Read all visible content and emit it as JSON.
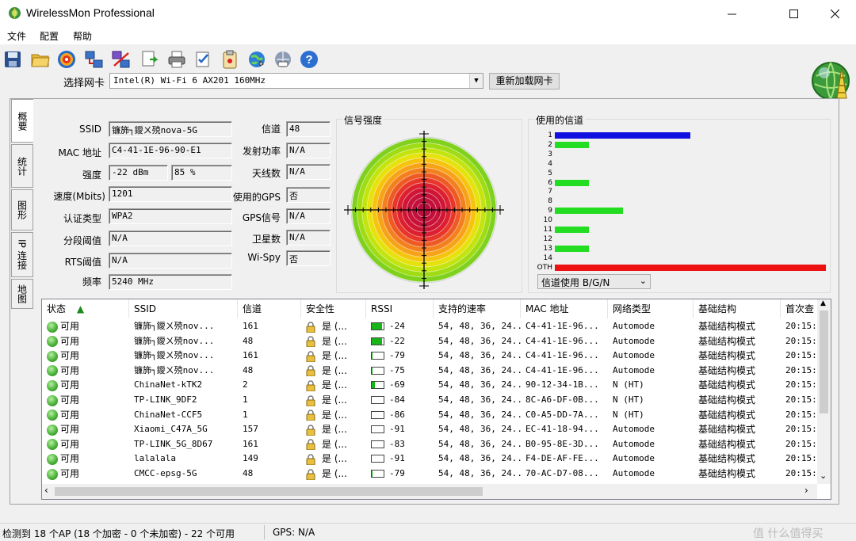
{
  "window": {
    "title": "WirelessMon Professional"
  },
  "menu": [
    "文件",
    "配置",
    "帮助"
  ],
  "toolbar": {
    "adapter_label": "选择网卡",
    "adapter_value": "Intel(R) Wi-Fi 6 AX201 160MHz",
    "reload_label": "重新加载网卡"
  },
  "tabs": [
    "概要",
    "统计",
    "图形",
    "IP 连接",
    "地图"
  ],
  "summary": {
    "ssid_label": "SSID",
    "ssid": "镰斾┐鑀ㄨ殑nova-5G",
    "mac_label": "MAC 地址",
    "mac": "C4-41-1E-96-90-E1",
    "strength_label": "强度",
    "strength_dbm": "-22 dBm",
    "strength_pct": "85 %",
    "speed_label": "速度(Mbits)",
    "speed": "1201",
    "auth_label": "认证类型",
    "auth": "WPA2",
    "frag_label": "分段阈值",
    "frag": "N/A",
    "rts_label": "RTS阈值",
    "rts": "N/A",
    "freq_label": "频率",
    "freq": "5240 MHz",
    "channel_label": "信道",
    "channel": "48",
    "txpower_label": "发射功率",
    "txpower": "N/A",
    "antenna_label": "天线数",
    "antenna": "N/A",
    "gps_used_label": "使用的GPS",
    "gps_used": "否",
    "gps_signal_label": "GPS信号",
    "gps_signal": "N/A",
    "satellite_label": "卫星数",
    "satellite": "N/A",
    "wispy_label": "Wi-Spy",
    "wispy": "否"
  },
  "signal_panel": {
    "title": "信号强度"
  },
  "channel_panel": {
    "title": "使用的信道",
    "select_value": "信道使用 B/G/N",
    "colors": {
      "blue": "#1010e0",
      "green": "#22dd22",
      "red": "#ee1111"
    }
  },
  "chart_data": {
    "type": "bar",
    "categories": [
      "1",
      "2",
      "3",
      "4",
      "5",
      "6",
      "7",
      "8",
      "9",
      "10",
      "11",
      "12",
      "13",
      "14",
      "OTH"
    ],
    "values": [
      4,
      1,
      0,
      0,
      0,
      1,
      0,
      0,
      2,
      0,
      1,
      0,
      1,
      0,
      8
    ],
    "bar_colors": [
      "blue",
      "green",
      "",
      "",
      "",
      "green",
      "",
      "",
      "green",
      "",
      "green",
      "",
      "green",
      "",
      "red"
    ]
  },
  "table": {
    "headers": [
      "状态",
      "SSID",
      "信道",
      "安全性",
      "RSSI",
      "支持的速率",
      "MAC 地址",
      "网络类型",
      "基础结构",
      "首次查"
    ],
    "rows": [
      {
        "status": "可用",
        "ssid": "镰斾┐鑀ㄨ殑nov...",
        "ch": "161",
        "sec": "是 (...",
        "rssi": "-24",
        "rssi_level": 0.85,
        "rates": "54, 48, 36, 24...",
        "mac": "C4-41-1E-96...",
        "net": "Automode",
        "infra": "基础结构模式",
        "first": "20:15:"
      },
      {
        "status": "可用",
        "ssid": "镰斾┐鑀ㄨ殑nov...",
        "ch": "48",
        "sec": "是 (...",
        "rssi": "-22",
        "rssi_level": 0.85,
        "rates": "54, 48, 36, 24...",
        "mac": "C4-41-1E-96...",
        "net": "Automode",
        "infra": "基础结构模式",
        "first": "20:15:"
      },
      {
        "status": "可用",
        "ssid": "镰斾┐鑀ㄨ殑nov...",
        "ch": "161",
        "sec": "是 (...",
        "rssi": "-79",
        "rssi_level": 0.08,
        "rates": "54, 48, 36, 24...",
        "mac": "C4-41-1E-96...",
        "net": "Automode",
        "infra": "基础结构模式",
        "first": "20:15:"
      },
      {
        "status": "可用",
        "ssid": "镰斾┐鑀ㄨ殑nov...",
        "ch": "48",
        "sec": "是 (...",
        "rssi": "-75",
        "rssi_level": 0.08,
        "rates": "54, 48, 36, 24...",
        "mac": "C4-41-1E-96...",
        "net": "Automode",
        "infra": "基础结构模式",
        "first": "20:15:"
      },
      {
        "status": "可用",
        "ssid": "ChinaNet-kTK2",
        "ch": "2",
        "sec": "是 (...",
        "rssi": "-69",
        "rssi_level": 0.25,
        "rates": "54, 48, 36, 24...",
        "mac": "90-12-34-1B...",
        "net": "N (HT)",
        "infra": "基础结构模式",
        "first": "20:15:"
      },
      {
        "status": "可用",
        "ssid": "TP-LINK_9DF2",
        "ch": "1",
        "sec": "是 (...",
        "rssi": "-84",
        "rssi_level": 0,
        "rates": "54, 48, 36, 24...",
        "mac": "8C-A6-DF-0B...",
        "net": "N (HT)",
        "infra": "基础结构模式",
        "first": "20:15:"
      },
      {
        "status": "可用",
        "ssid": "ChinaNet-CCF5",
        "ch": "1",
        "sec": "是 (...",
        "rssi": "-86",
        "rssi_level": 0,
        "rates": "54, 48, 36, 24...",
        "mac": "C0-A5-DD-7A...",
        "net": "N (HT)",
        "infra": "基础结构模式",
        "first": "20:15:"
      },
      {
        "status": "可用",
        "ssid": "Xiaomi_C47A_5G",
        "ch": "157",
        "sec": "是 (...",
        "rssi": "-91",
        "rssi_level": 0,
        "rates": "54, 48, 36, 24...",
        "mac": "EC-41-18-94...",
        "net": "Automode",
        "infra": "基础结构模式",
        "first": "20:15:"
      },
      {
        "status": "可用",
        "ssid": "TP-LINK_5G_8D67",
        "ch": "161",
        "sec": "是 (...",
        "rssi": "-83",
        "rssi_level": 0,
        "rates": "54, 48, 36, 24...",
        "mac": "B0-95-8E-3D...",
        "net": "Automode",
        "infra": "基础结构模式",
        "first": "20:15:"
      },
      {
        "status": "可用",
        "ssid": "lalalala",
        "ch": "149",
        "sec": "是 (...",
        "rssi": "-91",
        "rssi_level": 0,
        "rates": "54, 48, 36, 24...",
        "mac": "F4-DE-AF-FE...",
        "net": "Automode",
        "infra": "基础结构模式",
        "first": "20:15:"
      },
      {
        "status": "可用",
        "ssid": "CMCC-epsg-5G",
        "ch": "48",
        "sec": "是 (...",
        "rssi": "-79",
        "rssi_level": 0.08,
        "rates": "54, 48, 36, 24...",
        "mac": "70-AC-D7-08...",
        "net": "Automode",
        "infra": "基础结构模式",
        "first": "20:15:"
      }
    ]
  },
  "statusbar": {
    "text": "检测到 18 个AP (18 个加密 - 0 个未加密) - 22 个可用",
    "gps": "GPS: N/A",
    "watermark": "值 什么值得买"
  }
}
